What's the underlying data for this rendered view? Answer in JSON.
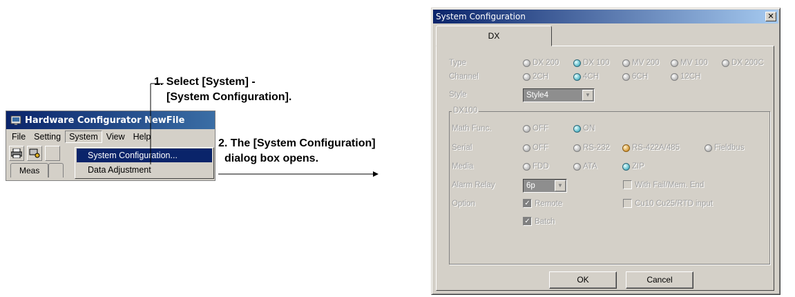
{
  "app": {
    "title": "Hardware Configurator NewFile",
    "menu": [
      "File",
      "Setting",
      "System",
      "View",
      "Help"
    ],
    "tab_visible": "Meas",
    "dropdown_items": [
      "System Configuration...",
      "Data Adjustment"
    ]
  },
  "callouts": {
    "step1_line1": "1. Select [System] -",
    "step1_line2": "[System Configuration].",
    "step2_line1": "2. The [System Configuration]",
    "step2_line2": "dialog box opens."
  },
  "dialog": {
    "title": "System Configuration",
    "close_glyph": "✕",
    "tab": "DX",
    "type": {
      "label": "Type",
      "options": [
        "DX 200",
        "DX 100",
        "MV 200",
        "MV 100",
        "DX 200C"
      ],
      "selected": "DX 100"
    },
    "channel": {
      "label": "Channel",
      "options": [
        "2CH",
        "4CH",
        "6CH",
        "12CH"
      ],
      "selected": "4CH"
    },
    "style": {
      "label": "Style",
      "value": "Style4"
    },
    "group": {
      "label": "DX100",
      "math": {
        "label": "Math Func.",
        "options": [
          "OFF",
          "ON"
        ],
        "selected": "ON"
      },
      "serial": {
        "label": "Serial",
        "options": [
          "OFF",
          "RS-232",
          "RS-422A/485",
          "Fieldbus"
        ],
        "selected": "RS-422A/485"
      },
      "media": {
        "label": "Media",
        "options": [
          "FDD",
          "ATA",
          "ZIP"
        ],
        "selected": "ZIP"
      },
      "alarm_relay": {
        "label": "Alarm Relay",
        "value": "6p"
      },
      "with_fail": {
        "label": "With Fail/Mem. End",
        "checked": false
      },
      "option": {
        "label": "Option"
      },
      "remote": {
        "label": "Remote",
        "checked": true
      },
      "cu10": {
        "label": "Cu10 Cu25/RTD input",
        "checked": false
      },
      "batch": {
        "label": "Batch",
        "checked": true
      }
    },
    "ok": "OK",
    "cancel": "Cancel"
  },
  "colors": {
    "titlebar": "#0a246a",
    "face": "#d4d0c8",
    "radio_selected": "#56b8c8",
    "radio_rs422": "#d59a3a"
  }
}
